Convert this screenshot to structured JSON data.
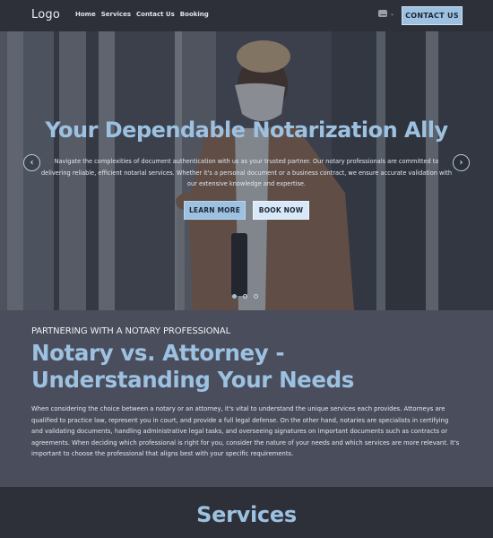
{
  "nav": {
    "logo": "Logo",
    "links": [
      "Home",
      "Services",
      "Contact Us",
      "Booking"
    ],
    "language_icon": "flag-icon",
    "language_chevron": "chevron-down-icon",
    "contact_button": "CONTACT US"
  },
  "hero": {
    "title": "Your Dependable Notarization Ally",
    "text": "Navigate the complexities of document authentication with us as your trusted partner. Our notary professionals are committed to delivering reliable, efficient notarial services. Whether it's a personal document or a business contract, we ensure accurate validation with our extensive knowledge and expertise.",
    "prev_arrow": "‹",
    "next_arrow": "›",
    "buttons": {
      "learn_more": "LEARN MORE",
      "book_now": "BOOK NOW"
    },
    "slides": 3,
    "active_slide": 1
  },
  "about": {
    "eyebrow": "PARTNERING WITH A NOTARY PROFESSIONAL",
    "title": "Notary vs. Attorney - Understanding Your Needs",
    "text": "When considering the choice between a notary or an attorney, it's vital to understand the unique services each provides. Attorneys are qualified to practice law, represent you in court, and provide a full legal defense. On the other hand, notaries are specialists in certifying and validating documents, handling administrative legal tasks, and overseeing signatures on important documents such as contracts or agreements. When deciding which professional is right for you, consider the nature of your needs and which services are more relevant. It's important to choose the professional that aligns best with your specific requirements."
  },
  "services": {
    "title": "Services"
  },
  "colors": {
    "accent": "#9dc1e1",
    "nav_bg": "#2e3039",
    "section_bg": "#4a4e5c",
    "button_light": "#d7e8f8"
  }
}
